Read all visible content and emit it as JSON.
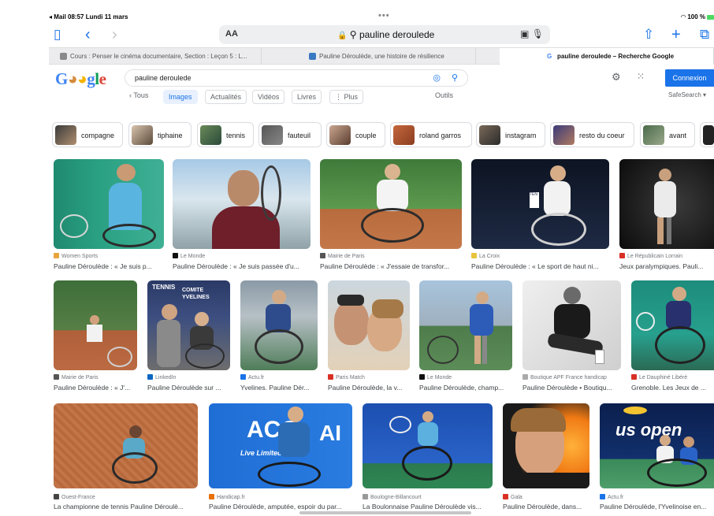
{
  "status": {
    "left": "◂ Mail  08:57  Lundi 11 mars",
    "center": "•••",
    "right": "100 %"
  },
  "toolbar": {
    "aa": "AA",
    "url": "pauline deroulede"
  },
  "tabs": [
    {
      "label": "Cours : Penser le cinéma documentaire, Section : Leçon 5 : L..."
    },
    {
      "label": "Pauline Déroulède, une histoire de résilience"
    },
    {
      "label": ""
    },
    {
      "label": "pauline deroulede – Recherche Google"
    }
  ],
  "google": {
    "logo": "Google",
    "query": "pauline deroulede",
    "signin": "Connexion"
  },
  "filters": {
    "back": "‹ Tous",
    "images": "Images",
    "news": "Actualités",
    "videos": "Vidéos",
    "books": "Livres",
    "more": "⋮ Plus",
    "tools": "Outils",
    "safe": "SafeSearch ▾"
  },
  "chips": [
    "compagne",
    "tiphaine",
    "tennis",
    "fauteuil",
    "couple",
    "roland garros",
    "instagram",
    "resto du coeur",
    "avant"
  ],
  "results": [
    {
      "source": "Women Sports",
      "caption": "Pauline Déroulède : « Je suis p..."
    },
    {
      "source": "Le Monde",
      "caption": "Pauline Déroulède : « Je suis passée d'u..."
    },
    {
      "source": "Mairie de Paris",
      "caption": "Pauline Déroulède : « J'essaie de transfor..."
    },
    {
      "source": "La Croix",
      "caption": "Pauline Déroulède : « Le sport de haut ni..."
    },
    {
      "source": "Le Républicain Lorrain",
      "caption": "Jeux paralympiques. Pauli..."
    },
    {
      "source": "Mairie de Paris",
      "caption": "Pauline Déroulède : « J'..."
    },
    {
      "source": "LinkedIn",
      "caption": "Pauline Déroulède sur ..."
    },
    {
      "source": "Actu.fr",
      "caption": "Yvelines. Pauline Dér..."
    },
    {
      "source": "Paris Match",
      "caption": "Pauline Déroulède, la v..."
    },
    {
      "source": "Le Monde",
      "caption": "Pauline Déroulède, champ..."
    },
    {
      "source": "Boutique APF France handicap",
      "caption": "Pauline Déroulède • Boutiqu..."
    },
    {
      "source": "Le Dauphiné Libéré",
      "caption": "Grenoble. Les Jeux de ..."
    },
    {
      "source": "Ouest-France",
      "caption": "La championne de tennis Pauline Déroulè..."
    },
    {
      "source": "Handicap.fr",
      "caption": "Pauline Déroulède, amputée, espoir du par..."
    },
    {
      "source": "Boulogne-Billancourt",
      "caption": "La Boulonnaise Pauline Déroulède vis..."
    },
    {
      "source": "Gala",
      "caption": "Pauline Déroulède, dans..."
    },
    {
      "source": "Actu.fr",
      "caption": "Pauline Déroulède, l'Yvelinoise en..."
    }
  ],
  "image_text": {
    "tenis": "TENNIS",
    "comite": "COMITE YVELINES",
    "usopen": "us open",
    "acc": "ACC",
    "live": "Live Limited",
    "ten": "TEN"
  },
  "colors": {
    "accent": "#1a73e8",
    "chip_border": "#dadce0"
  }
}
